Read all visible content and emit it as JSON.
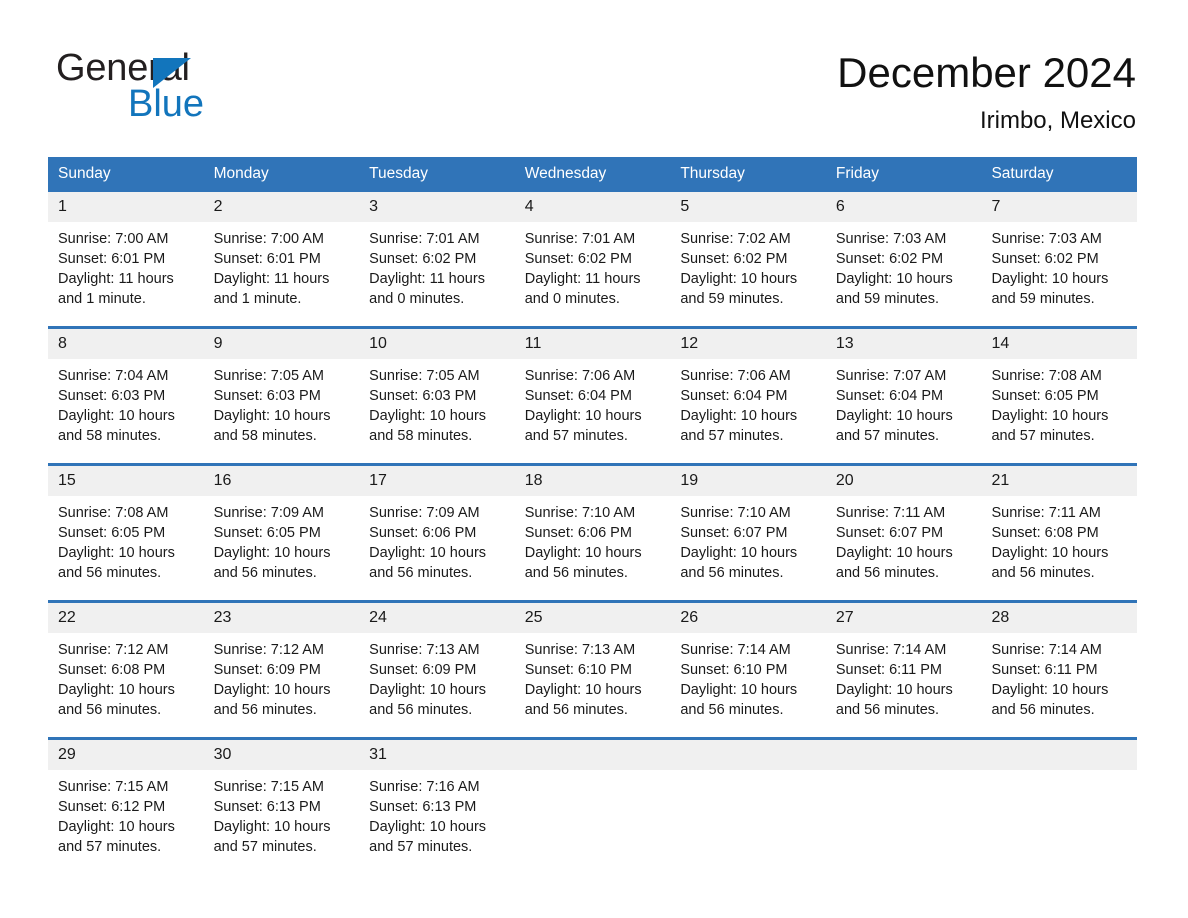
{
  "brand": {
    "line1": "General",
    "line2": "Blue",
    "triangle_color": "#1275bc",
    "text_color": "#231f20"
  },
  "header": {
    "title": "December 2024",
    "subtitle": "Irimbo, Mexico"
  },
  "colors": {
    "header_blue": "#3074b8",
    "daynum_band": "#f0f0f0",
    "text": "#1a1a1a",
    "page_background": "#ffffff"
  },
  "weekday_headers": [
    "Sunday",
    "Monday",
    "Tuesday",
    "Wednesday",
    "Thursday",
    "Friday",
    "Saturday"
  ],
  "weeks": [
    {
      "days": [
        {
          "date": "1",
          "sunrise": "Sunrise: 7:00 AM",
          "sunset": "Sunset: 6:01 PM",
          "daylight_line1": "Daylight: 11 hours",
          "daylight_line2": "and 1 minute."
        },
        {
          "date": "2",
          "sunrise": "Sunrise: 7:00 AM",
          "sunset": "Sunset: 6:01 PM",
          "daylight_line1": "Daylight: 11 hours",
          "daylight_line2": "and 1 minute."
        },
        {
          "date": "3",
          "sunrise": "Sunrise: 7:01 AM",
          "sunset": "Sunset: 6:02 PM",
          "daylight_line1": "Daylight: 11 hours",
          "daylight_line2": "and 0 minutes."
        },
        {
          "date": "4",
          "sunrise": "Sunrise: 7:01 AM",
          "sunset": "Sunset: 6:02 PM",
          "daylight_line1": "Daylight: 11 hours",
          "daylight_line2": "and 0 minutes."
        },
        {
          "date": "5",
          "sunrise": "Sunrise: 7:02 AM",
          "sunset": "Sunset: 6:02 PM",
          "daylight_line1": "Daylight: 10 hours",
          "daylight_line2": "and 59 minutes."
        },
        {
          "date": "6",
          "sunrise": "Sunrise: 7:03 AM",
          "sunset": "Sunset: 6:02 PM",
          "daylight_line1": "Daylight: 10 hours",
          "daylight_line2": "and 59 minutes."
        },
        {
          "date": "7",
          "sunrise": "Sunrise: 7:03 AM",
          "sunset": "Sunset: 6:02 PM",
          "daylight_line1": "Daylight: 10 hours",
          "daylight_line2": "and 59 minutes."
        }
      ]
    },
    {
      "days": [
        {
          "date": "8",
          "sunrise": "Sunrise: 7:04 AM",
          "sunset": "Sunset: 6:03 PM",
          "daylight_line1": "Daylight: 10 hours",
          "daylight_line2": "and 58 minutes."
        },
        {
          "date": "9",
          "sunrise": "Sunrise: 7:05 AM",
          "sunset": "Sunset: 6:03 PM",
          "daylight_line1": "Daylight: 10 hours",
          "daylight_line2": "and 58 minutes."
        },
        {
          "date": "10",
          "sunrise": "Sunrise: 7:05 AM",
          "sunset": "Sunset: 6:03 PM",
          "daylight_line1": "Daylight: 10 hours",
          "daylight_line2": "and 58 minutes."
        },
        {
          "date": "11",
          "sunrise": "Sunrise: 7:06 AM",
          "sunset": "Sunset: 6:04 PM",
          "daylight_line1": "Daylight: 10 hours",
          "daylight_line2": "and 57 minutes."
        },
        {
          "date": "12",
          "sunrise": "Sunrise: 7:06 AM",
          "sunset": "Sunset: 6:04 PM",
          "daylight_line1": "Daylight: 10 hours",
          "daylight_line2": "and 57 minutes."
        },
        {
          "date": "13",
          "sunrise": "Sunrise: 7:07 AM",
          "sunset": "Sunset: 6:04 PM",
          "daylight_line1": "Daylight: 10 hours",
          "daylight_line2": "and 57 minutes."
        },
        {
          "date": "14",
          "sunrise": "Sunrise: 7:08 AM",
          "sunset": "Sunset: 6:05 PM",
          "daylight_line1": "Daylight: 10 hours",
          "daylight_line2": "and 57 minutes."
        }
      ]
    },
    {
      "days": [
        {
          "date": "15",
          "sunrise": "Sunrise: 7:08 AM",
          "sunset": "Sunset: 6:05 PM",
          "daylight_line1": "Daylight: 10 hours",
          "daylight_line2": "and 56 minutes."
        },
        {
          "date": "16",
          "sunrise": "Sunrise: 7:09 AM",
          "sunset": "Sunset: 6:05 PM",
          "daylight_line1": "Daylight: 10 hours",
          "daylight_line2": "and 56 minutes."
        },
        {
          "date": "17",
          "sunrise": "Sunrise: 7:09 AM",
          "sunset": "Sunset: 6:06 PM",
          "daylight_line1": "Daylight: 10 hours",
          "daylight_line2": "and 56 minutes."
        },
        {
          "date": "18",
          "sunrise": "Sunrise: 7:10 AM",
          "sunset": "Sunset: 6:06 PM",
          "daylight_line1": "Daylight: 10 hours",
          "daylight_line2": "and 56 minutes."
        },
        {
          "date": "19",
          "sunrise": "Sunrise: 7:10 AM",
          "sunset": "Sunset: 6:07 PM",
          "daylight_line1": "Daylight: 10 hours",
          "daylight_line2": "and 56 minutes."
        },
        {
          "date": "20",
          "sunrise": "Sunrise: 7:11 AM",
          "sunset": "Sunset: 6:07 PM",
          "daylight_line1": "Daylight: 10 hours",
          "daylight_line2": "and 56 minutes."
        },
        {
          "date": "21",
          "sunrise": "Sunrise: 7:11 AM",
          "sunset": "Sunset: 6:08 PM",
          "daylight_line1": "Daylight: 10 hours",
          "daylight_line2": "and 56 minutes."
        }
      ]
    },
    {
      "days": [
        {
          "date": "22",
          "sunrise": "Sunrise: 7:12 AM",
          "sunset": "Sunset: 6:08 PM",
          "daylight_line1": "Daylight: 10 hours",
          "daylight_line2": "and 56 minutes."
        },
        {
          "date": "23",
          "sunrise": "Sunrise: 7:12 AM",
          "sunset": "Sunset: 6:09 PM",
          "daylight_line1": "Daylight: 10 hours",
          "daylight_line2": "and 56 minutes."
        },
        {
          "date": "24",
          "sunrise": "Sunrise: 7:13 AM",
          "sunset": "Sunset: 6:09 PM",
          "daylight_line1": "Daylight: 10 hours",
          "daylight_line2": "and 56 minutes."
        },
        {
          "date": "25",
          "sunrise": "Sunrise: 7:13 AM",
          "sunset": "Sunset: 6:10 PM",
          "daylight_line1": "Daylight: 10 hours",
          "daylight_line2": "and 56 minutes."
        },
        {
          "date": "26",
          "sunrise": "Sunrise: 7:14 AM",
          "sunset": "Sunset: 6:10 PM",
          "daylight_line1": "Daylight: 10 hours",
          "daylight_line2": "and 56 minutes."
        },
        {
          "date": "27",
          "sunrise": "Sunrise: 7:14 AM",
          "sunset": "Sunset: 6:11 PM",
          "daylight_line1": "Daylight: 10 hours",
          "daylight_line2": "and 56 minutes."
        },
        {
          "date": "28",
          "sunrise": "Sunrise: 7:14 AM",
          "sunset": "Sunset: 6:11 PM",
          "daylight_line1": "Daylight: 10 hours",
          "daylight_line2": "and 56 minutes."
        }
      ]
    },
    {
      "days": [
        {
          "date": "29",
          "sunrise": "Sunrise: 7:15 AM",
          "sunset": "Sunset: 6:12 PM",
          "daylight_line1": "Daylight: 10 hours",
          "daylight_line2": "and 57 minutes."
        },
        {
          "date": "30",
          "sunrise": "Sunrise: 7:15 AM",
          "sunset": "Sunset: 6:13 PM",
          "daylight_line1": "Daylight: 10 hours",
          "daylight_line2": "and 57 minutes."
        },
        {
          "date": "31",
          "sunrise": "Sunrise: 7:16 AM",
          "sunset": "Sunset: 6:13 PM",
          "daylight_line1": "Daylight: 10 hours",
          "daylight_line2": "and 57 minutes."
        },
        {
          "date": "",
          "sunrise": "",
          "sunset": "",
          "daylight_line1": "",
          "daylight_line2": ""
        },
        {
          "date": "",
          "sunrise": "",
          "sunset": "",
          "daylight_line1": "",
          "daylight_line2": ""
        },
        {
          "date": "",
          "sunrise": "",
          "sunset": "",
          "daylight_line1": "",
          "daylight_line2": ""
        },
        {
          "date": "",
          "sunrise": "",
          "sunset": "",
          "daylight_line1": "",
          "daylight_line2": ""
        }
      ]
    }
  ]
}
